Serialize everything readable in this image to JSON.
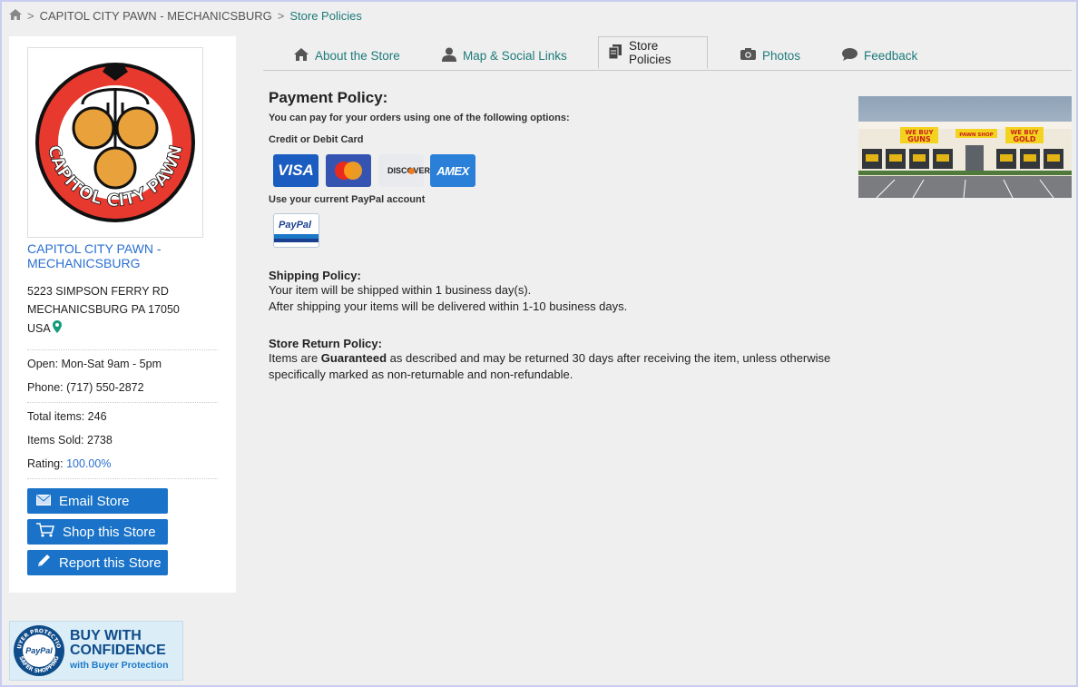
{
  "breadcrumb": {
    "store": "CAPITOL CITY PAWN - MECHANICSBURG",
    "current": "Store Policies"
  },
  "sidebar": {
    "logo_text": "CAPITOL CITY PAWN",
    "store_name_line1": "CAPITOL CITY PAWN -",
    "store_name_line2": "MECHANICSBURG",
    "address_line1": "5223 SIMPSON FERRY RD",
    "address_line2": "MECHANICSBURG PA 17050",
    "country": "USA",
    "hours": "Open: Mon-Sat 9am - 5pm",
    "phone": "Phone: (717) 550-2872",
    "total_items": "Total items: 246",
    "items_sold": "Items Sold: 2738",
    "rating_label": "Rating:",
    "rating_value": "100.00%",
    "buttons": {
      "email": "Email Store",
      "shop": "Shop this Store",
      "report": "Report this Store"
    }
  },
  "badge": {
    "seal_top": "BUYER PROTECTION",
    "seal_bottom": "SAFER SHOPPING",
    "seal_center": "PayPal",
    "line1": "BUY WITH",
    "line2": "CONFIDENCE",
    "line3": "with Buyer Protection"
  },
  "tabs": [
    {
      "label": "About the Store",
      "icon": "home-icon"
    },
    {
      "label": "Map & Social Links",
      "icon": "person-icon"
    },
    {
      "label": "Store Policies",
      "icon": "document-icon"
    },
    {
      "label": "Photos",
      "icon": "camera-icon"
    },
    {
      "label": "Feedback",
      "icon": "speech-bubble-icon"
    }
  ],
  "payment": {
    "title": "Payment Policy:",
    "intro": "You can pay for your orders using one of the following options:",
    "card_label": "Credit or Debit Card",
    "cards": [
      "VISA",
      "mastercard",
      "DISCOVER",
      "AMEX"
    ],
    "paypal_label": "Use your current PayPal account",
    "paypal_logo": "PayPal"
  },
  "shipping": {
    "title": "Shipping Policy:",
    "line1": "Your item will be shipped within 1 business day(s).",
    "line2": "After shipping your items will be delivered within 1-10 business days."
  },
  "returns": {
    "title": "Store Return Policy:",
    "prefix": "Items are ",
    "bold": "Guaranteed",
    "line1_rest": " as described and may be returned 30 days after receiving the item, unless otherwise",
    "line2": "specifically marked as non-returnable and non-refundable."
  },
  "photo": {
    "sign1_a": "WE BUY",
    "sign1_b": "GUNS",
    "sign_center": "PAWN SHOP",
    "sign2_a": "WE BUY",
    "sign2_b": "GOLD"
  },
  "colors": {
    "link": "#2a6fd1",
    "teal": "#1e7a7a",
    "button": "#1a73c8"
  }
}
